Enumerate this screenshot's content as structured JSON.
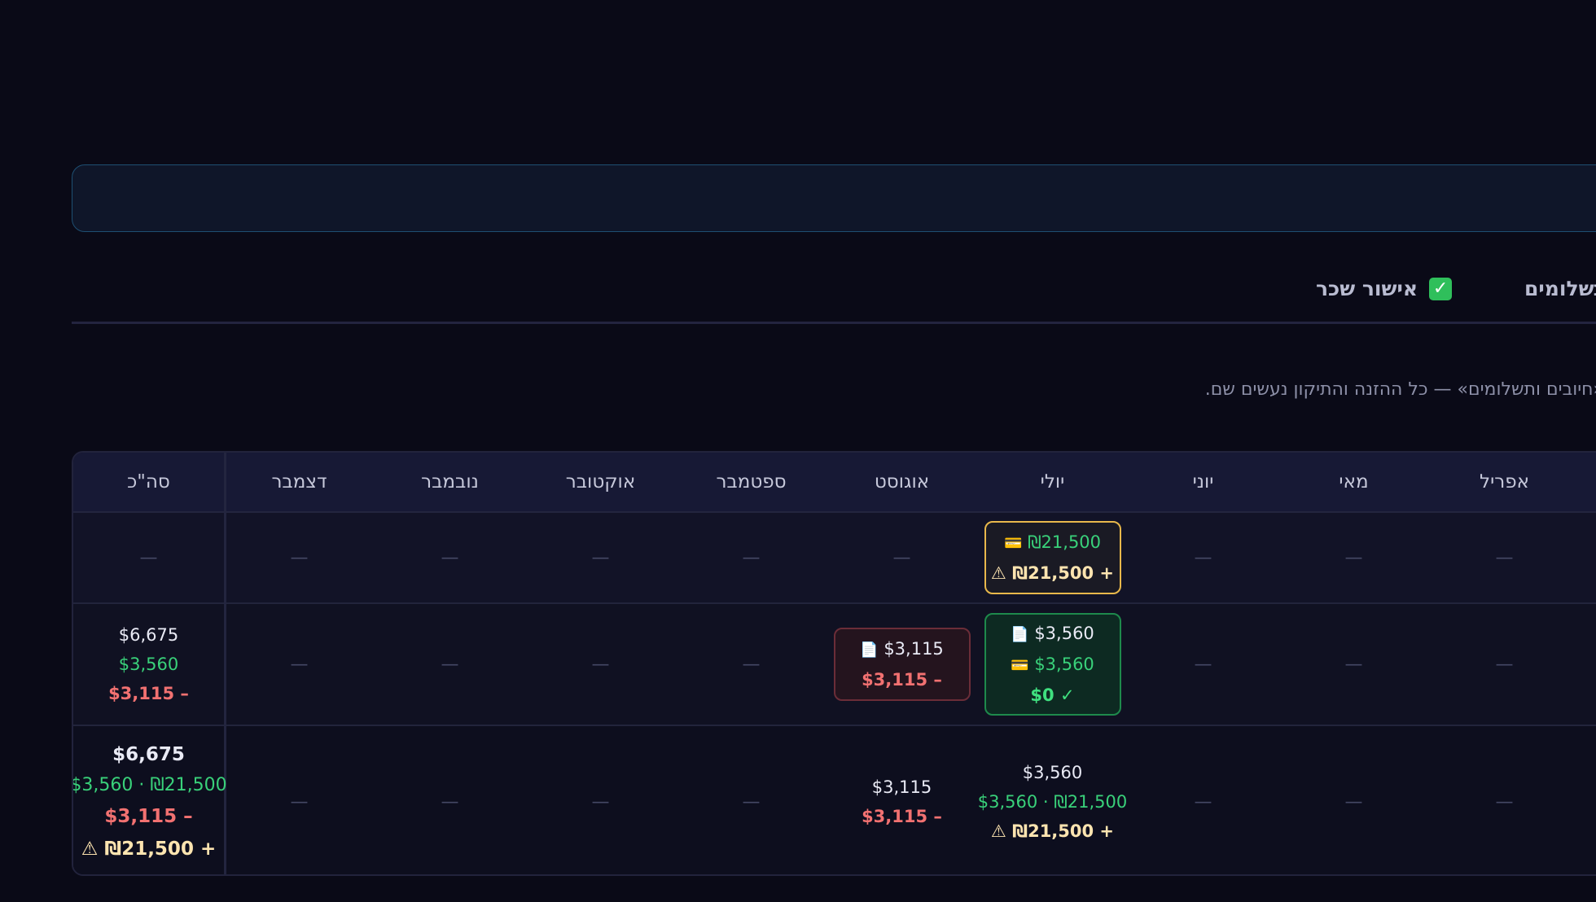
{
  "tabs": {
    "approve_label": "אישור שכר",
    "payments_label": "תשלומים"
  },
  "hint": "«חיובים ותשלומים» — כל ההזנה והתיקון נעשים שם.",
  "table": {
    "headers": {
      "total": "סה\"כ",
      "dec": "דצמבר",
      "nov": "נובמבר",
      "oct": "אוקטובר",
      "sep": "ספטמבר",
      "aug": "אוגוסט",
      "jul": "יולי",
      "jun": "יוני",
      "may": "מאי",
      "apr": "אפריל"
    },
    "dash": "—",
    "row1": {
      "jul_paid": "₪21,500",
      "jul_diff": "₪21,500 +",
      "warn_icon": "⚠"
    },
    "row2": {
      "total_billed": "$6,675",
      "total_paid": "$3,560",
      "total_diff": "$3,115 –",
      "aug_billed": "$3,115",
      "aug_diff": "$3,115 –",
      "jul_billed": "$3,560",
      "jul_paid": "$3,560",
      "jul_diff": "$0 ✓"
    },
    "row3": {
      "total_billed": "$6,675",
      "total_paid": "$3,560 · ₪21,500",
      "total_diff_usd": "$3,115 –",
      "total_diff_ils": "₪21,500 +",
      "aug_billed": "$3,115",
      "aug_diff": "$3,115 –",
      "jul_billed": "$3,560",
      "jul_paid": "$3,560 · ₪21,500",
      "jul_diff": "₪21,500 +"
    }
  }
}
